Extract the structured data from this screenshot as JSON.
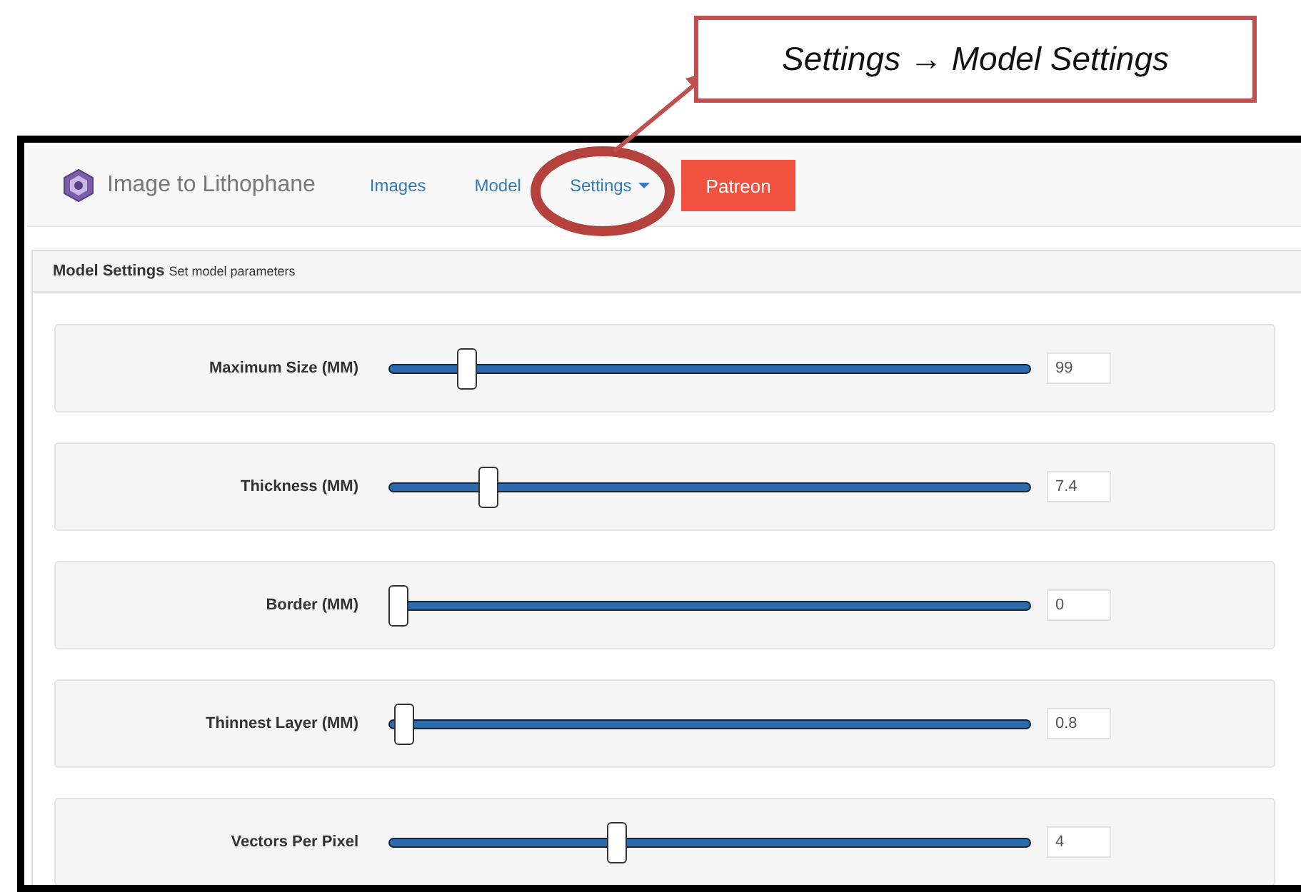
{
  "annotation": {
    "text": "Settings → Model Settings"
  },
  "navbar": {
    "brand": "Image to Lithophane",
    "items": [
      {
        "label": "Images",
        "kind": "link"
      },
      {
        "label": "Model",
        "kind": "link"
      },
      {
        "label": "Settings",
        "kind": "dropdown"
      },
      {
        "label": "Patreon",
        "kind": "button"
      }
    ]
  },
  "panel": {
    "title": "Model Settings",
    "subtitle": "Set model parameters"
  },
  "settings": [
    {
      "label": "Maximum Size (MM)",
      "level": 0.11,
      "value": "99"
    },
    {
      "label": "Thickness (MM)",
      "level": 0.145,
      "value": "7.4"
    },
    {
      "label": "Border (MM)",
      "level": 0.0,
      "value": "0"
    },
    {
      "label": "Thinnest Layer (MM)",
      "level": 0.01,
      "value": "0.8"
    },
    {
      "label": "Vectors Per Pixel",
      "level": 0.35,
      "value": "4"
    }
  ]
}
